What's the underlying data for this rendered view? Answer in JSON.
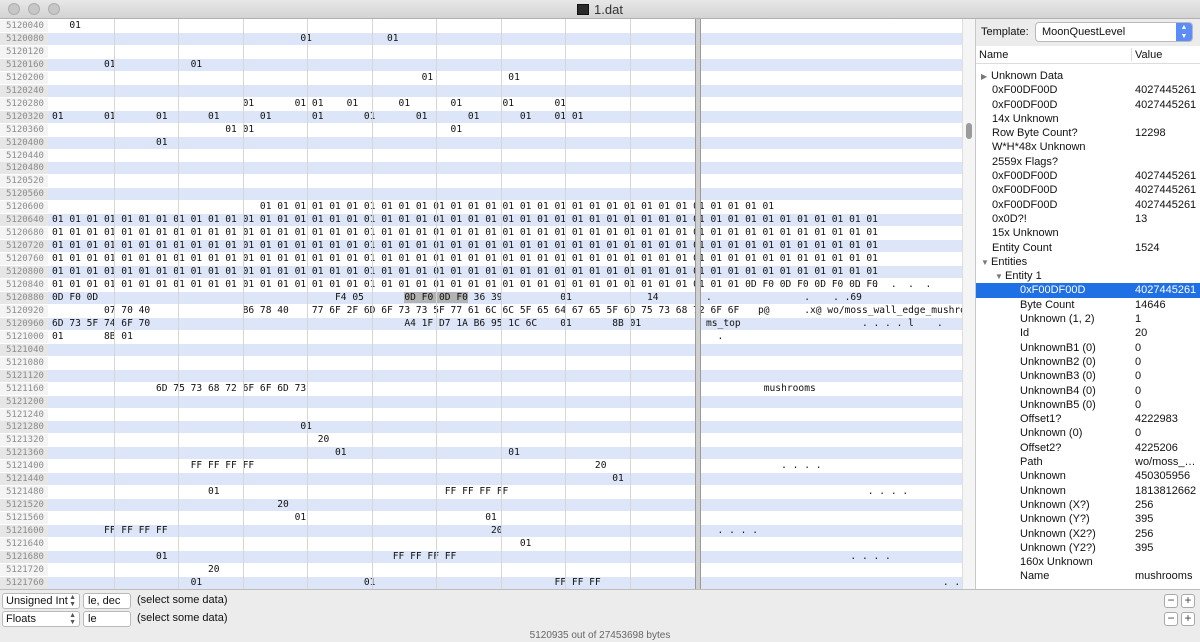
{
  "window": {
    "title": "1.dat"
  },
  "hex_rows": [
    {
      "off": "5120040",
      "hex": "   01",
      "asc": ""
    },
    {
      "off": "5120080",
      "hex": "                                           01             01",
      "asc": ""
    },
    {
      "off": "5120120",
      "hex": "",
      "asc": ""
    },
    {
      "off": "5120160",
      "hex": "         01             01",
      "asc": ""
    },
    {
      "off": "5120200",
      "hex": "                                                                01             01",
      "asc": ""
    },
    {
      "off": "5120240",
      "hex": "",
      "asc": ""
    },
    {
      "off": "5120280",
      "hex": "                                 01       01 01    01       01       01       01       01",
      "asc": ""
    },
    {
      "off": "5120320",
      "hex": "01       01       01       01       01       01       01       01       01       01    01 01",
      "asc": ""
    },
    {
      "off": "5120360",
      "hex": "                              01 01                                  01",
      "asc": ""
    },
    {
      "off": "5120400",
      "hex": "                  01",
      "asc": ""
    },
    {
      "off": "5120440",
      "hex": "",
      "asc": ""
    },
    {
      "off": "5120480",
      "hex": "",
      "asc": ""
    },
    {
      "off": "5120520",
      "hex": "",
      "asc": ""
    },
    {
      "off": "5120560",
      "hex": "",
      "asc": ""
    },
    {
      "off": "5120600",
      "hex": "                                    01 01 01 01 01 01 01 01 01 01 01 01 01 01 01 01 01 01 01 01 01 01 01 01 01 01 01 01 01 01",
      "asc": ""
    },
    {
      "off": "5120640",
      "hex": "01 01 01 01 01 01 01 01 01 01 01 01 01 01 01 01 01 01 01 01 01 01 01 01 01 01 01 01 01 01 01 01 01 01 01 01 01 01 01 01 01 01 01 01 01 01 01 01",
      "asc": ""
    },
    {
      "off": "5120680",
      "hex": "01 01 01 01 01 01 01 01 01 01 01 01 01 01 01 01 01 01 01 01 01 01 01 01 01 01 01 01 01 01 01 01 01 01 01 01 01 01 01 01 01 01 01 01 01 01 01 01",
      "asc": ""
    },
    {
      "off": "5120720",
      "hex": "01 01 01 01 01 01 01 01 01 01 01 01 01 01 01 01 01 01 01 01 01 01 01 01 01 01 01 01 01 01 01 01 01 01 01 01 01 01 01 01 01 01 01 01 01 01 01 01",
      "asc": ""
    },
    {
      "off": "5120760",
      "hex": "01 01 01 01 01 01 01 01 01 01 01 01 01 01 01 01 01 01 01 01 01 01 01 01 01 01 01 01 01 01 01 01 01 01 01 01 01 01 01 01 01 01 01 01 01 01 01 01",
      "asc": ""
    },
    {
      "off": "5120800",
      "hex": "01 01 01 01 01 01 01 01 01 01 01 01 01 01 01 01 01 01 01 01 01 01 01 01 01 01 01 01 01 01 01 01 01 01 01 01 01 01 01 01 01 01 01 01 01 01 01 01",
      "asc": ""
    },
    {
      "off": "5120840",
      "hex": "01 01 01 01 01 01 01 01 01 01 01 01 01 01 01 01 01 01 01 01 01 01 01 01 01 01 01 01 01 01 01 01 01 01 01 01 01 01 01 01 0D F0 0D F0 0D F0 0D F0",
      "asc": "                          .  .  .  .  ."
    },
    {
      "off": "5120880",
      "hex": "0D F0 0D                                         F4 05       0D F0 0D F0 36 39          01             14",
      "asc": ".                .    . .69"
    },
    {
      "off": "5120920",
      "hex": "         07 70 40                B6 78 40    77 6F 2F 6D 6F 73 73 5F 77 61 6C 6C 5F 65 64 67 65 5F 6D 75 73 68 72 6F 6F",
      "asc": "         p@      .x@ wo/moss_wall_edge_mushroo"
    },
    {
      "off": "5120960",
      "hex": "6D 73 5F 74 6F 70                                            A4 1F D7 1A B6 95 1C 6C    01       8B 01",
      "asc": "ms_top                     . . . . l    ."
    },
    {
      "off": "5121000",
      "hex": "01       8B 01",
      "asc": "  ."
    },
    {
      "off": "5121040",
      "hex": "",
      "asc": ""
    },
    {
      "off": "5121080",
      "hex": "",
      "asc": ""
    },
    {
      "off": "5121120",
      "hex": "",
      "asc": ""
    },
    {
      "off": "5121160",
      "hex": "                  6D 75 73 68 72 6F 6F 6D 73",
      "asc": "          mushrooms"
    },
    {
      "off": "5121200",
      "hex": "",
      "asc": ""
    },
    {
      "off": "5121240",
      "hex": "",
      "asc": ""
    },
    {
      "off": "5121280",
      "hex": "                                           01",
      "asc": ""
    },
    {
      "off": "5121320",
      "hex": "                                              20",
      "asc": ""
    },
    {
      "off": "5121360",
      "hex": "                                                 01                            01",
      "asc": ""
    },
    {
      "off": "5121400",
      "hex": "                        FF FF FF FF                                                           20",
      "asc": "             . . . ."
    },
    {
      "off": "5121440",
      "hex": "                                                                                                 01",
      "asc": ""
    },
    {
      "off": "5121480",
      "hex": "                           01                                       FF FF FF FF",
      "asc": "                            . . . ."
    },
    {
      "off": "5121520",
      "hex": "                                       20",
      "asc": ""
    },
    {
      "off": "5121560",
      "hex": "                                          01                               01",
      "asc": ""
    },
    {
      "off": "5121600",
      "hex": "         FF FF FF FF                                                        20",
      "asc": "  . . . ."
    },
    {
      "off": "5121640",
      "hex": "                                                                                 01",
      "asc": ""
    },
    {
      "off": "5121680",
      "hex": "                  01                                       FF FF FF FF",
      "asc": "                         . . . ."
    },
    {
      "off": "5121720",
      "hex": "                           20",
      "asc": ""
    },
    {
      "off": "5121760",
      "hex": "                        01                            01                               FF FF FF",
      "asc": "                                         . . ."
    },
    {
      "off": "5121800",
      "hex": "FF                                                                  20",
      "asc": "."
    }
  ],
  "template_panel": {
    "label": "Template:",
    "selected": "MoonQuestLevel",
    "col_name": "Name",
    "col_value": "Value",
    "rows": [
      {
        "n": "Unknown Data",
        "v": "",
        "ind": 0,
        "tri": "▶"
      },
      {
        "n": "0xF00DF00D",
        "v": "4027445261",
        "ind": 0,
        "tri": ""
      },
      {
        "n": "0xF00DF00D",
        "v": "4027445261",
        "ind": 0,
        "tri": ""
      },
      {
        "n": "14x Unknown",
        "v": "",
        "ind": 0,
        "tri": ""
      },
      {
        "n": "Row Byte Count?",
        "v": "12298",
        "ind": 0,
        "tri": ""
      },
      {
        "n": "W*H*48x Unknown",
        "v": "",
        "ind": 0,
        "tri": ""
      },
      {
        "n": "2559x Flags?",
        "v": "",
        "ind": 0,
        "tri": ""
      },
      {
        "n": "0xF00DF00D",
        "v": "4027445261",
        "ind": 0,
        "tri": ""
      },
      {
        "n": "0xF00DF00D",
        "v": "4027445261",
        "ind": 0,
        "tri": ""
      },
      {
        "n": "0xF00DF00D",
        "v": "4027445261",
        "ind": 0,
        "tri": ""
      },
      {
        "n": "0x0D?!",
        "v": "13",
        "ind": 0,
        "tri": ""
      },
      {
        "n": "15x Unknown",
        "v": "",
        "ind": 0,
        "tri": ""
      },
      {
        "n": "Entity Count",
        "v": "1524",
        "ind": 0,
        "tri": ""
      },
      {
        "n": "Entities",
        "v": "",
        "ind": 0,
        "tri": "▼"
      },
      {
        "n": "Entity 1",
        "v": "",
        "ind": 1,
        "tri": "▼"
      },
      {
        "n": "0xF00DF00D",
        "v": "4027445261",
        "ind": 2,
        "tri": "",
        "sel": true
      },
      {
        "n": "Byte Count",
        "v": "14646",
        "ind": 2,
        "tri": ""
      },
      {
        "n": "Unknown (1, 2)",
        "v": "1",
        "ind": 2,
        "tri": ""
      },
      {
        "n": "Id",
        "v": "20",
        "ind": 2,
        "tri": ""
      },
      {
        "n": "UnknownB1 (0)",
        "v": "0",
        "ind": 2,
        "tri": ""
      },
      {
        "n": "UnknownB2 (0)",
        "v": "0",
        "ind": 2,
        "tri": ""
      },
      {
        "n": "UnknownB3 (0)",
        "v": "0",
        "ind": 2,
        "tri": ""
      },
      {
        "n": "UnknownB4 (0)",
        "v": "0",
        "ind": 2,
        "tri": ""
      },
      {
        "n": "UnknownB5 (0)",
        "v": "0",
        "ind": 2,
        "tri": ""
      },
      {
        "n": "Offset1?",
        "v": "4222983",
        "ind": 2,
        "tri": ""
      },
      {
        "n": "Unknown (0)",
        "v": "0",
        "ind": 2,
        "tri": ""
      },
      {
        "n": "Offset2?",
        "v": "4225206",
        "ind": 2,
        "tri": ""
      },
      {
        "n": "Path",
        "v": "wo/moss_…",
        "ind": 2,
        "tri": ""
      },
      {
        "n": "Unknown",
        "v": "450305956",
        "ind": 2,
        "tri": ""
      },
      {
        "n": "Unknown",
        "v": "1813812662",
        "ind": 2,
        "tri": ""
      },
      {
        "n": "Unknown (X?)",
        "v": "256",
        "ind": 2,
        "tri": ""
      },
      {
        "n": "Unknown (Y?)",
        "v": "395",
        "ind": 2,
        "tri": ""
      },
      {
        "n": "Unknown (X2?)",
        "v": "256",
        "ind": 2,
        "tri": ""
      },
      {
        "n": "Unknown (Y2?)",
        "v": "395",
        "ind": 2,
        "tri": ""
      },
      {
        "n": "160x Unknown",
        "v": "",
        "ind": 2,
        "tri": ""
      },
      {
        "n": "Name",
        "v": "mushrooms",
        "ind": 2,
        "tri": ""
      }
    ]
  },
  "inspector": [
    {
      "type": "Unsigned Int",
      "endian": "le, dec",
      "msg": "(select some data)"
    },
    {
      "type": "Floats",
      "endian": "le",
      "msg": "(select some data)"
    }
  ],
  "status": "5120935 out of 27453698 bytes"
}
